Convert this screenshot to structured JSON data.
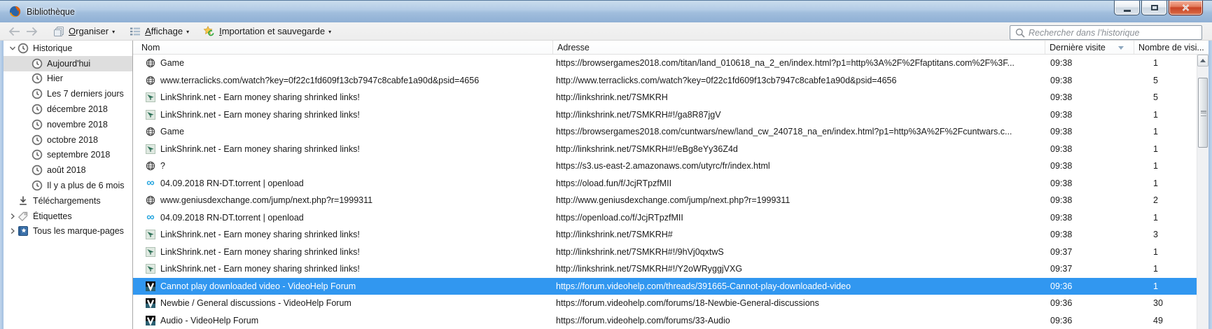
{
  "window": {
    "title": "Bibliothèque",
    "controls": [
      {
        "id": "minimize",
        "icon": "minimize-icon"
      },
      {
        "id": "maximize",
        "icon": "maximize-icon"
      },
      {
        "id": "close",
        "icon": "close-icon"
      }
    ]
  },
  "toolbar": {
    "nav": [
      {
        "id": "back",
        "icon": "back-arrow-icon"
      },
      {
        "id": "forward",
        "icon": "forward-arrow-icon"
      }
    ],
    "menus": [
      {
        "id": "organize",
        "label": "Organiser",
        "icon": "organize-icon"
      },
      {
        "id": "views",
        "label": "Affichage",
        "icon": "view-list-icon"
      },
      {
        "id": "import-backup",
        "label": "Importation et sauvegarde",
        "icon": "import-backup-icon"
      }
    ],
    "search": {
      "placeholder": "Rechercher dans l’historique",
      "value": "",
      "icon": "search-icon"
    }
  },
  "sidebar": {
    "items": [
      {
        "id": "historique",
        "label": "Historique",
        "icon": "clock-icon",
        "level": 0,
        "twisty": "open",
        "selected": false
      },
      {
        "id": "aujourdhui",
        "label": "Aujourd'hui",
        "icon": "clock-icon",
        "level": 1,
        "twisty": "none",
        "selected": true
      },
      {
        "id": "hier",
        "label": "Hier",
        "icon": "clock-icon",
        "level": 1,
        "twisty": "none",
        "selected": false
      },
      {
        "id": "7-derniers-jours",
        "label": "Les 7 derniers jours",
        "icon": "clock-icon",
        "level": 1,
        "twisty": "none",
        "selected": false
      },
      {
        "id": "decembre-2018",
        "label": "décembre 2018",
        "icon": "clock-icon",
        "level": 1,
        "twisty": "none",
        "selected": false
      },
      {
        "id": "novembre-2018",
        "label": "novembre 2018",
        "icon": "clock-icon",
        "level": 1,
        "twisty": "none",
        "selected": false
      },
      {
        "id": "octobre-2018",
        "label": "octobre 2018",
        "icon": "clock-icon",
        "level": 1,
        "twisty": "none",
        "selected": false
      },
      {
        "id": "septembre-2018",
        "label": "septembre 2018",
        "icon": "clock-icon",
        "level": 1,
        "twisty": "none",
        "selected": false
      },
      {
        "id": "aout-2018",
        "label": "août 2018",
        "icon": "clock-icon",
        "level": 1,
        "twisty": "none",
        "selected": false
      },
      {
        "id": "plus-de-6-mois",
        "label": "Il y a plus de 6 mois",
        "icon": "clock-icon",
        "level": 1,
        "twisty": "none",
        "selected": false
      },
      {
        "id": "telechargements",
        "label": "Téléchargements",
        "icon": "download-icon",
        "level": 0,
        "twisty": "none",
        "selected": false
      },
      {
        "id": "etiquettes",
        "label": "Étiquettes",
        "icon": "tag-icon",
        "level": 0,
        "twisty": "closed",
        "selected": false
      },
      {
        "id": "marque-pages",
        "label": "Tous les marque-pages",
        "icon": "bookmarks-icon",
        "level": 0,
        "twisty": "closed",
        "selected": false
      }
    ]
  },
  "table": {
    "columns": [
      {
        "id": "name",
        "label": "Nom",
        "sort": "none"
      },
      {
        "id": "address",
        "label": "Adresse",
        "sort": "none"
      },
      {
        "id": "last_visit",
        "label": "Dernière visite",
        "sort": "desc"
      },
      {
        "id": "visits",
        "label": "Nombre de visi...",
        "sort": "none"
      }
    ],
    "rows": [
      {
        "name": "Game",
        "icon": "globe-icon",
        "address": "https://browsergames2018.com/titan/land_010618_na_2_en/index.html?p1=http%3A%2F%2Ffaptitans.com%2F%3F...",
        "last_visit": "09:38",
        "visits": "1",
        "selected": false
      },
      {
        "name": "www.terraclicks.com/watch?key=0f22c1fd609f13cb7947c8cabfe1a90d&psid=4656",
        "icon": "globe-icon",
        "address": "http://www.terraclicks.com/watch?key=0f22c1fd609f13cb7947c8cabfe1a90d&psid=4656",
        "last_visit": "09:38",
        "visits": "5",
        "selected": false
      },
      {
        "name": "LinkShrink.net - Earn money sharing shrinked links!",
        "icon": "linkshrink-icon",
        "address": "http://linkshrink.net/7SMKRH",
        "last_visit": "09:38",
        "visits": "5",
        "selected": false
      },
      {
        "name": "LinkShrink.net - Earn money sharing shrinked links!",
        "icon": "linkshrink-icon",
        "address": "http://linkshrink.net/7SMKRH#!/ga8R87jgV",
        "last_visit": "09:38",
        "visits": "1",
        "selected": false
      },
      {
        "name": "Game",
        "icon": "globe-icon",
        "address": "https://browsergames2018.com/cuntwars/new/land_cw_240718_na_en/index.html?p1=http%3A%2F%2Fcuntwars.c...",
        "last_visit": "09:38",
        "visits": "1",
        "selected": false
      },
      {
        "name": "LinkShrink.net - Earn money sharing shrinked links!",
        "icon": "linkshrink-icon",
        "address": "http://linkshrink.net/7SMKRH#!/eBg8eYy36Z4d",
        "last_visit": "09:38",
        "visits": "1",
        "selected": false
      },
      {
        "name": "?",
        "icon": "globe-icon",
        "address": "https://s3.us-east-2.amazonaws.com/utyrc/fr/index.html",
        "last_visit": "09:38",
        "visits": "1",
        "selected": false
      },
      {
        "name": "04.09.2018 RN-DT.torrent | openload",
        "icon": "openload-icon",
        "address": "https://oload.fun/f/JcjRTpzfMII",
        "last_visit": "09:38",
        "visits": "1",
        "selected": false
      },
      {
        "name": "www.geniusdexchange.com/jump/next.php?r=1999311",
        "icon": "globe-icon",
        "address": "http://www.geniusdexchange.com/jump/next.php?r=1999311",
        "last_visit": "09:38",
        "visits": "2",
        "selected": false
      },
      {
        "name": "04.09.2018 RN-DT.torrent | openload",
        "icon": "openload-icon",
        "address": "https://openload.co/f/JcjRTpzfMII",
        "last_visit": "09:38",
        "visits": "1",
        "selected": false
      },
      {
        "name": "LinkShrink.net - Earn money sharing shrinked links!",
        "icon": "linkshrink-icon",
        "address": "http://linkshrink.net/7SMKRH#",
        "last_visit": "09:38",
        "visits": "3",
        "selected": false
      },
      {
        "name": "LinkShrink.net - Earn money sharing shrinked links!",
        "icon": "linkshrink-icon",
        "address": "http://linkshrink.net/7SMKRH#!/9hVj0qxtwS",
        "last_visit": "09:37",
        "visits": "1",
        "selected": false
      },
      {
        "name": "LinkShrink.net - Earn money sharing shrinked links!",
        "icon": "linkshrink-icon",
        "address": "http://linkshrink.net/7SMKRH#!/Y2oWRyggjVXG",
        "last_visit": "09:37",
        "visits": "1",
        "selected": false
      },
      {
        "name": "Cannot play downloaded video - VideoHelp Forum",
        "icon": "videohelp-icon",
        "address": "https://forum.videohelp.com/threads/391665-Cannot-play-downloaded-video",
        "last_visit": "09:36",
        "visits": "1",
        "selected": true
      },
      {
        "name": "Newbie / General discussions - VideoHelp Forum",
        "icon": "videohelp-icon",
        "address": "https://forum.videohelp.com/forums/18-Newbie-General-discussions",
        "last_visit": "09:36",
        "visits": "30",
        "selected": false
      },
      {
        "name": "Audio - VideoHelp Forum",
        "icon": "videohelp-icon",
        "address": "https://forum.videohelp.com/forums/33-Audio",
        "last_visit": "09:36",
        "visits": "49",
        "selected": false
      }
    ]
  },
  "colors": {
    "selection_blue": "#3197f0",
    "titlebar_blue": "#a9c4e0",
    "toolbar_gray": "#f0f0f0",
    "close_button_red": "#c94426",
    "openload_blue": "#2ba7df",
    "linkshrink_green": "#2e7158",
    "videohelp_teal": "#2b6072"
  }
}
